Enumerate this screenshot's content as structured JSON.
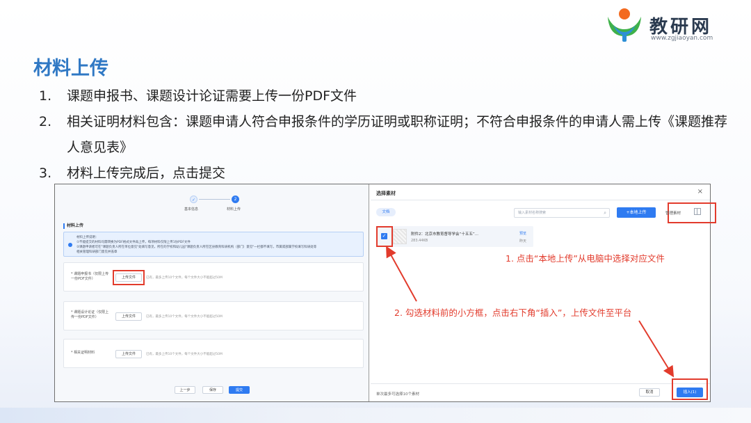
{
  "logo": {
    "brand": "教研网",
    "url": "www.zgjiaoyan.com"
  },
  "slide": {
    "title": "材料上传",
    "points": [
      {
        "num": "1.",
        "text": "课题申报书、课题设计论证需要上传一份PDF文件"
      },
      {
        "num": "2.",
        "text": "相关证明材料包含：课题申请人符合申报条件的学历证明或职称证明；不符合申报条件的申请人需上传《课题推荐人意见表》"
      },
      {
        "num": "3.",
        "text": "材料上传完成后，点击提交"
      }
    ]
  },
  "left_form": {
    "steps": [
      {
        "icon": "✓",
        "label": "基本信息"
      },
      {
        "icon": "2",
        "label": "材料上传"
      }
    ],
    "section_title": "材料上传",
    "notice_lines": [
      "材料上传说明：",
      "①不能提交的材料均需转换为PDF格式文件再上传，每项材料仅限上传1份PDF文件",
      "②课题申请者可在\"课题负责人所在单位意见\"处填写意见，所在的学校和幼儿园\"课题负责人所在区县教育科研机构（部门）意见\"一栏都不填写，市属或部属学校填写科研处等",
      "相关管理科研部门意见并盖章"
    ],
    "fields": [
      {
        "label": "* 课题申报书（仅限上传一份PDF文件）",
        "button": "上传文件",
        "hint": "已有，最多上传10个文件，每个文件大小不能超过50M"
      },
      {
        "label": "* 课题设计论证（仅限上传一份PDF文件）",
        "button": "上传文件",
        "hint": "已有，最多上传10个文件，每个文件大小不能超过50M"
      },
      {
        "label": "* 相关证明材料",
        "button": "上传文件",
        "hint": "已有，最多上传10个文件，每个文件大小不能超过50M"
      }
    ],
    "buttons": {
      "prev": "上一步",
      "save": "保存",
      "submit": "提交"
    }
  },
  "dialog": {
    "title": "选择素材",
    "close": "×",
    "tab": "文档",
    "search_placeholder": "输入素材名称搜索",
    "local_upload": "+本地上传",
    "manage": "管理素材",
    "file": {
      "name": "附件2：北京市教育督导学会“十五五”...",
      "size": "283.44KB",
      "preview": "预览",
      "date": "昨天"
    },
    "footer_note": "单次最多可选择10个素材",
    "cancel": "取消",
    "insert": "插入(1)"
  },
  "callouts": {
    "step1": "1. 点击“本地上传”从电脑中选择对应文件",
    "step2": "2. 勾选材料前的小方框，点击右下角“插入”，上传文件至平台"
  },
  "colors": {
    "title_blue": "#2f78c4",
    "accent_blue": "#2f7bf1",
    "highlight_red": "#e23b2c"
  }
}
